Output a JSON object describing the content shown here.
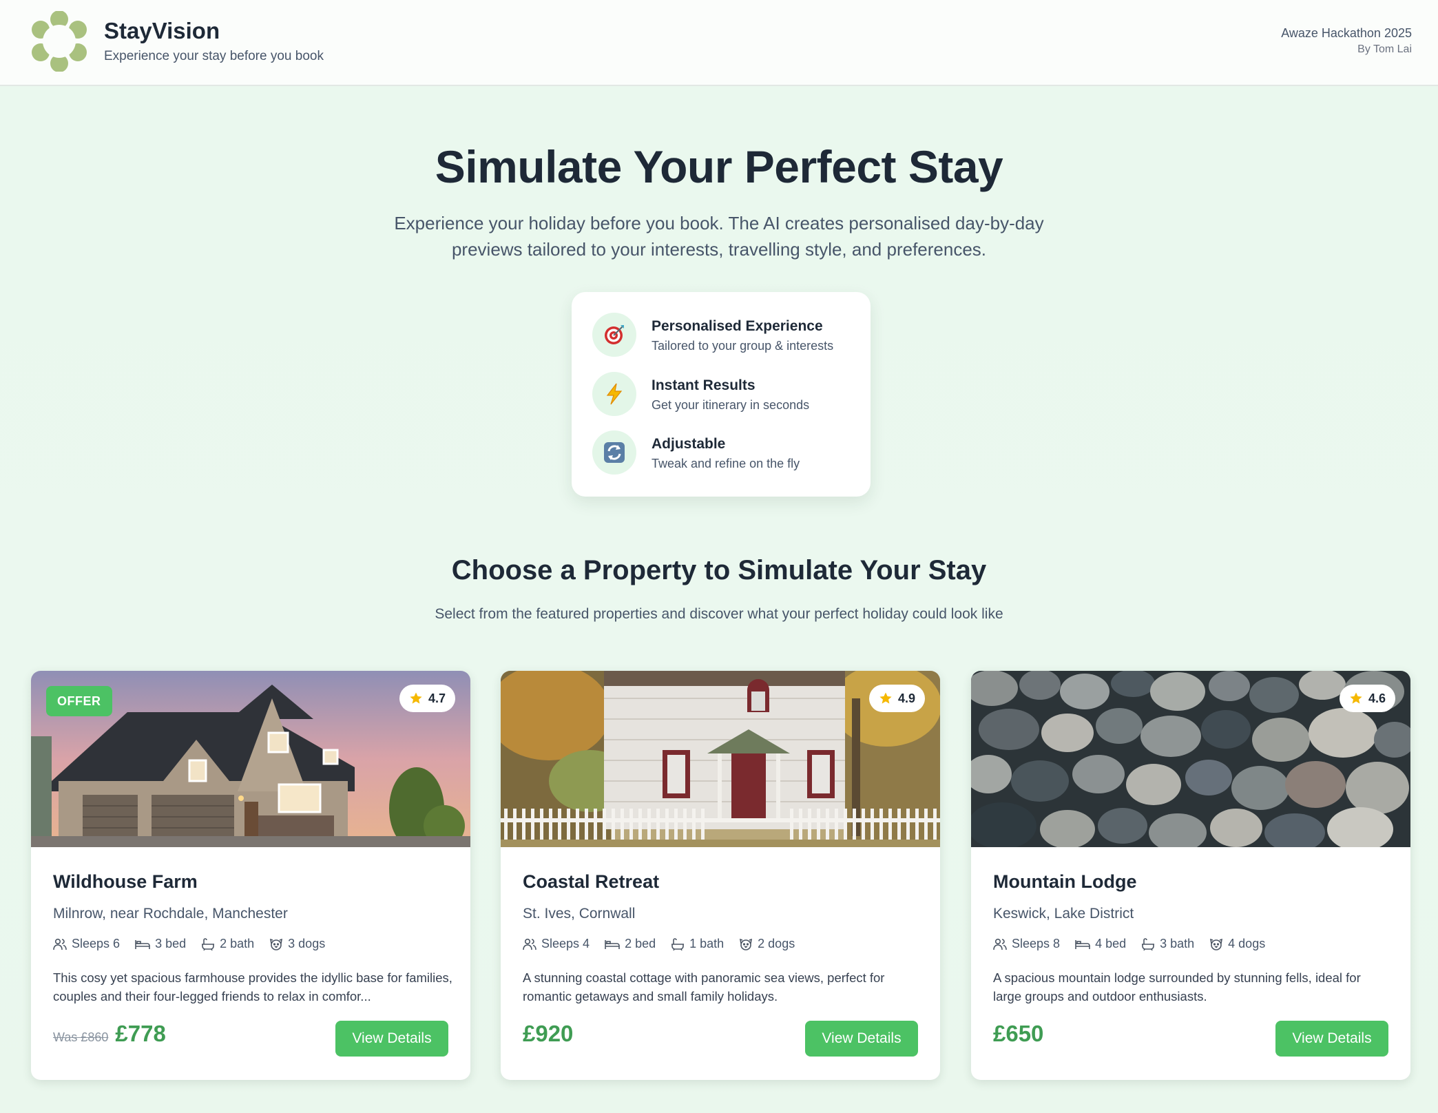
{
  "header": {
    "brand_name": "StayVision",
    "tagline": "Experience your stay before you book",
    "event": "Awaze Hackathon 2025",
    "author": "By Tom Lai",
    "logo_color": "#a9c17f"
  },
  "hero": {
    "title": "Simulate Your Perfect Stay",
    "description": "Experience your holiday before you book. The AI creates personalised day-by-day previews tailored to your interests, travelling style, and preferences."
  },
  "features": [
    {
      "icon": "target-icon",
      "title": "Personalised Experience",
      "description": "Tailored to your group & interests"
    },
    {
      "icon": "lightning-icon",
      "title": "Instant Results",
      "description": "Get your itinerary in seconds"
    },
    {
      "icon": "refresh-icon",
      "title": "Adjustable",
      "description": "Tweak and refine on the fly"
    }
  ],
  "section": {
    "title": "Choose a Property to Simulate Your Stay",
    "subtitle": "Select from the featured properties and discover what your perfect holiday could look like"
  },
  "properties": [
    {
      "name": "Wildhouse Farm",
      "location": "Milnrow, near Rochdale, Manchester",
      "rating": "4.7",
      "badge": "OFFER",
      "sleeps": "Sleeps 6",
      "beds": "3 bed",
      "baths": "2 bath",
      "dogs": "3 dogs",
      "description": "This cosy yet spacious farmhouse provides the idyllic base for families, couples and their four-legged friends to relax in comfor...",
      "was_price": "Was £860",
      "price": "£778",
      "button": "View Details",
      "image": "farmhouse-photo"
    },
    {
      "name": "Coastal Retreat",
      "location": "St. Ives, Cornwall",
      "rating": "4.9",
      "sleeps": "Sleeps 4",
      "beds": "2 bed",
      "baths": "1 bath",
      "dogs": "2 dogs",
      "description": "A stunning coastal cottage with panoramic sea views, perfect for romantic getaways and small family holidays.",
      "price": "£920",
      "button": "View Details",
      "image": "cottage-photo"
    },
    {
      "name": "Mountain Lodge",
      "location": "Keswick, Lake District",
      "rating": "4.6",
      "sleeps": "Sleeps 8",
      "beds": "4 bed",
      "baths": "3 bath",
      "dogs": "4 dogs",
      "description": "A spacious mountain lodge surrounded by stunning fells, ideal for large groups and outdoor enthusiasts.",
      "price": "£650",
      "button": "View Details",
      "image": "pebbles-photo"
    }
  ],
  "colors": {
    "accent_green": "#4cc264",
    "price_green": "#3f9c53",
    "star_yellow": "#f5b800"
  }
}
